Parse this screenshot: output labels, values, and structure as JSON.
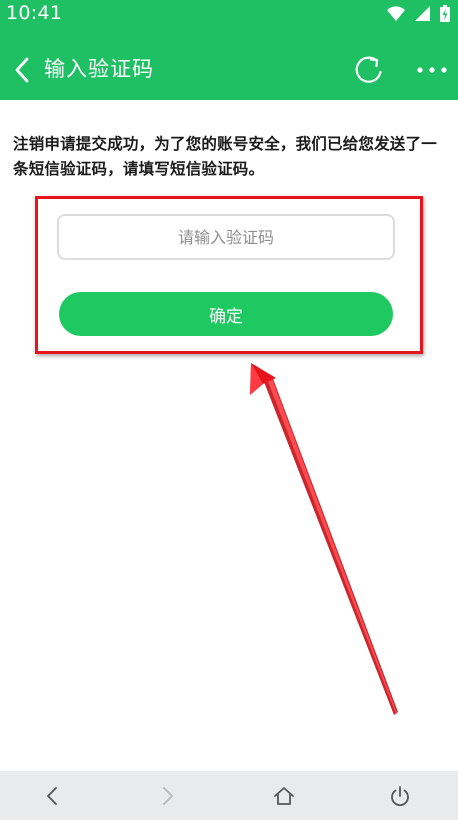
{
  "status_bar": {
    "time": "10:41"
  },
  "app_bar": {
    "title": "输入验证码",
    "back_icon": "chevron-left-icon",
    "refresh_icon": "refresh-icon",
    "more_icon": "more-dots-icon"
  },
  "notice": {
    "text": "注销申请提交成功，为了您的账号安全，我们已给您发送了一条短信验证码，请填写短信验证码。"
  },
  "form": {
    "code_input": {
      "placeholder": "请输入验证码",
      "value": ""
    },
    "confirm_label": "确定"
  },
  "nav_bar": {
    "icons": [
      "back-icon",
      "forward-icon",
      "home-icon",
      "power-icon"
    ]
  },
  "colors": {
    "brand_green": "#1ec063",
    "button_green": "#1ec961",
    "annotation_red": "#e8141c",
    "nav_bg": "#e9eaeb"
  }
}
